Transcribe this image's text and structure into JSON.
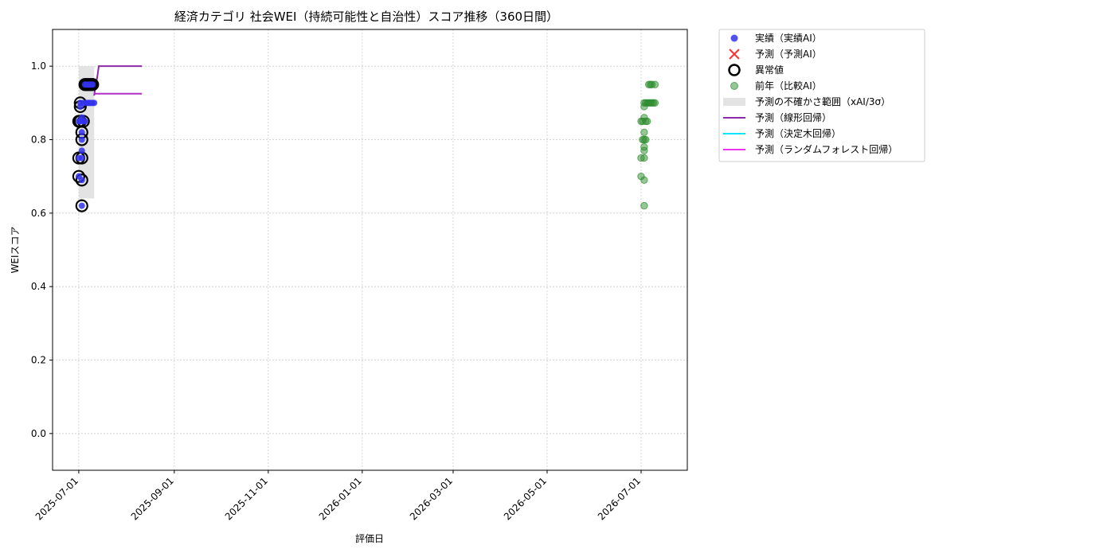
{
  "chart_data": {
    "type": "scatter",
    "title": "経済カテゴリ 社会WEI（持続可能性と自治性）スコア推移（360日間）",
    "xlabel": "評価日",
    "ylabel": "WEIスコア",
    "xlim": [
      "2025-06-14",
      "2026-07-31"
    ],
    "ylim": [
      -0.1,
      1.1
    ],
    "y_ticks": [
      "0.0",
      "0.2",
      "0.4",
      "0.6",
      "0.8",
      "1.0"
    ],
    "x_ticks": [
      "2025-07-01",
      "2025-09-01",
      "2025-11-01",
      "2026-01-01",
      "2026-03-01",
      "2026-05-01",
      "2026-07-01"
    ],
    "grid": true,
    "legend_position": "outside-top-right",
    "legend": [
      {
        "key": "actual",
        "label": "実績（実績AI）"
      },
      {
        "key": "forecast",
        "label": "予測（予測AI）"
      },
      {
        "key": "anomaly",
        "label": "異常値"
      },
      {
        "key": "prev_year",
        "label": "前年（比較AI）"
      },
      {
        "key": "uncertainty",
        "label": "予測の不確かさ範囲（xAI/3σ）"
      },
      {
        "key": "linear",
        "label": "予測（線形回帰）"
      },
      {
        "key": "tree",
        "label": "予測（決定木回帰）"
      },
      {
        "key": "forest",
        "label": "予測（ランダムフォレスト回帰）"
      }
    ],
    "colors": {
      "actual": "#3333ee",
      "forecast": "#ff3333",
      "anomaly": "#000000",
      "prev_year": "#2e8b2e",
      "uncertainty": "#d9d9d9",
      "linear": "#8b2aa8",
      "tree": "#00e5ff",
      "forest": "#ee33ee"
    },
    "actual": [
      {
        "x": "2025-07-01",
        "y": 0.7
      },
      {
        "x": "2025-07-01",
        "y": 0.75
      },
      {
        "x": "2025-07-01",
        "y": 0.85
      },
      {
        "x": "2025-07-02",
        "y": 0.85
      },
      {
        "x": "2025-07-02",
        "y": 0.89
      },
      {
        "x": "2025-07-02",
        "y": 0.9
      },
      {
        "x": "2025-07-03",
        "y": 0.62
      },
      {
        "x": "2025-07-03",
        "y": 0.69
      },
      {
        "x": "2025-07-03",
        "y": 0.75
      },
      {
        "x": "2025-07-03",
        "y": 0.77
      },
      {
        "x": "2025-07-03",
        "y": 0.8
      },
      {
        "x": "2025-07-03",
        "y": 0.82
      },
      {
        "x": "2025-07-03",
        "y": 0.86
      },
      {
        "x": "2025-07-04",
        "y": 0.85
      },
      {
        "x": "2025-07-04",
        "y": 0.9
      },
      {
        "x": "2025-07-05",
        "y": 0.95
      },
      {
        "x": "2025-07-05",
        "y": 0.85
      },
      {
        "x": "2025-07-06",
        "y": 0.9
      },
      {
        "x": "2025-07-06",
        "y": 0.95
      },
      {
        "x": "2025-07-07",
        "y": 0.9
      },
      {
        "x": "2025-07-07",
        "y": 0.95
      },
      {
        "x": "2025-07-08",
        "y": 0.95
      },
      {
        "x": "2025-07-08",
        "y": 0.9
      },
      {
        "x": "2025-07-09",
        "y": 0.95
      },
      {
        "x": "2025-07-09",
        "y": 0.9
      },
      {
        "x": "2025-07-10",
        "y": 0.95
      },
      {
        "x": "2025-07-10",
        "y": 0.9
      },
      {
        "x": "2025-07-11",
        "y": 0.9
      }
    ],
    "anomalies": [
      {
        "x": "2025-07-01",
        "y": 0.7
      },
      {
        "x": "2025-07-01",
        "y": 0.75
      },
      {
        "x": "2025-07-01",
        "y": 0.85
      },
      {
        "x": "2025-07-02",
        "y": 0.85
      },
      {
        "x": "2025-07-02",
        "y": 0.89
      },
      {
        "x": "2025-07-02",
        "y": 0.9
      },
      {
        "x": "2025-07-03",
        "y": 0.62
      },
      {
        "x": "2025-07-03",
        "y": 0.69
      },
      {
        "x": "2025-07-03",
        "y": 0.75
      },
      {
        "x": "2025-07-03",
        "y": 0.8
      },
      {
        "x": "2025-07-03",
        "y": 0.82
      },
      {
        "x": "2025-07-04",
        "y": 0.85
      },
      {
        "x": "2025-07-05",
        "y": 0.95
      },
      {
        "x": "2025-07-06",
        "y": 0.95
      },
      {
        "x": "2025-07-07",
        "y": 0.95
      },
      {
        "x": "2025-07-08",
        "y": 0.95
      },
      {
        "x": "2025-07-09",
        "y": 0.95
      },
      {
        "x": "2025-07-10",
        "y": 0.95
      }
    ],
    "prev_year": [
      {
        "x": "2026-07-01",
        "y": 0.7
      },
      {
        "x": "2026-07-01",
        "y": 0.75
      },
      {
        "x": "2026-07-01",
        "y": 0.85
      },
      {
        "x": "2026-07-02",
        "y": 0.85
      },
      {
        "x": "2026-07-02",
        "y": 0.8
      },
      {
        "x": "2026-07-03",
        "y": 0.62
      },
      {
        "x": "2026-07-03",
        "y": 0.69
      },
      {
        "x": "2026-07-03",
        "y": 0.75
      },
      {
        "x": "2026-07-03",
        "y": 0.77
      },
      {
        "x": "2026-07-03",
        "y": 0.78
      },
      {
        "x": "2026-07-03",
        "y": 0.8
      },
      {
        "x": "2026-07-03",
        "y": 0.82
      },
      {
        "x": "2026-07-03",
        "y": 0.86
      },
      {
        "x": "2026-07-03",
        "y": 0.89
      },
      {
        "x": "2026-07-03",
        "y": 0.9
      },
      {
        "x": "2026-07-04",
        "y": 0.8
      },
      {
        "x": "2026-07-04",
        "y": 0.85
      },
      {
        "x": "2026-07-04",
        "y": 0.9
      },
      {
        "x": "2026-07-05",
        "y": 0.85
      },
      {
        "x": "2026-07-05",
        "y": 0.9
      },
      {
        "x": "2026-07-06",
        "y": 0.95
      },
      {
        "x": "2026-07-06",
        "y": 0.9
      },
      {
        "x": "2026-07-07",
        "y": 0.9
      },
      {
        "x": "2026-07-07",
        "y": 0.95
      },
      {
        "x": "2026-07-08",
        "y": 0.9
      },
      {
        "x": "2026-07-08",
        "y": 0.95
      },
      {
        "x": "2026-07-09",
        "y": 0.9
      },
      {
        "x": "2026-07-10",
        "y": 0.95
      },
      {
        "x": "2026-07-10",
        "y": 0.9
      }
    ],
    "uncertainty_band": {
      "x_start": "2025-07-01",
      "x_end": "2025-07-11",
      "y_low": 0.64,
      "y_high": 1.0
    },
    "linear_regression": [
      {
        "x": "2025-07-11",
        "y": 0.92
      },
      {
        "x": "2025-07-12",
        "y": 0.95
      },
      {
        "x": "2025-07-13",
        "y": 0.97
      },
      {
        "x": "2025-07-14",
        "y": 1.0
      },
      {
        "x": "2025-08-11",
        "y": 1.0
      }
    ],
    "forest_regression": [
      {
        "x": "2025-07-11",
        "y": 0.925
      },
      {
        "x": "2025-08-11",
        "y": 0.925
      }
    ]
  }
}
